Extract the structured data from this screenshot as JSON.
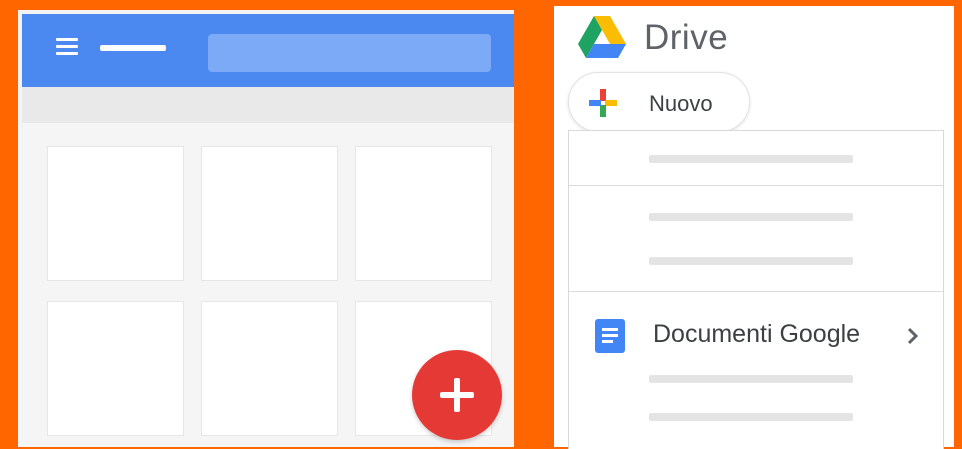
{
  "drive": {
    "title": "Drive",
    "new_button_label": "Nuovo",
    "menu": {
      "docs_item_label": "Documenti Google"
    }
  },
  "icons": {
    "menu": "hamburger-menu-icon",
    "fab": "add-icon",
    "logo": "google-drive-logo-icon",
    "new": "multicolor-plus-icon",
    "docs": "google-docs-icon",
    "chevron": "chevron-right-icon"
  },
  "colors": {
    "background": "#ff6600",
    "appbar": "#4b88ef",
    "fab": "#e53935",
    "docs_blue": "#4285f4"
  }
}
